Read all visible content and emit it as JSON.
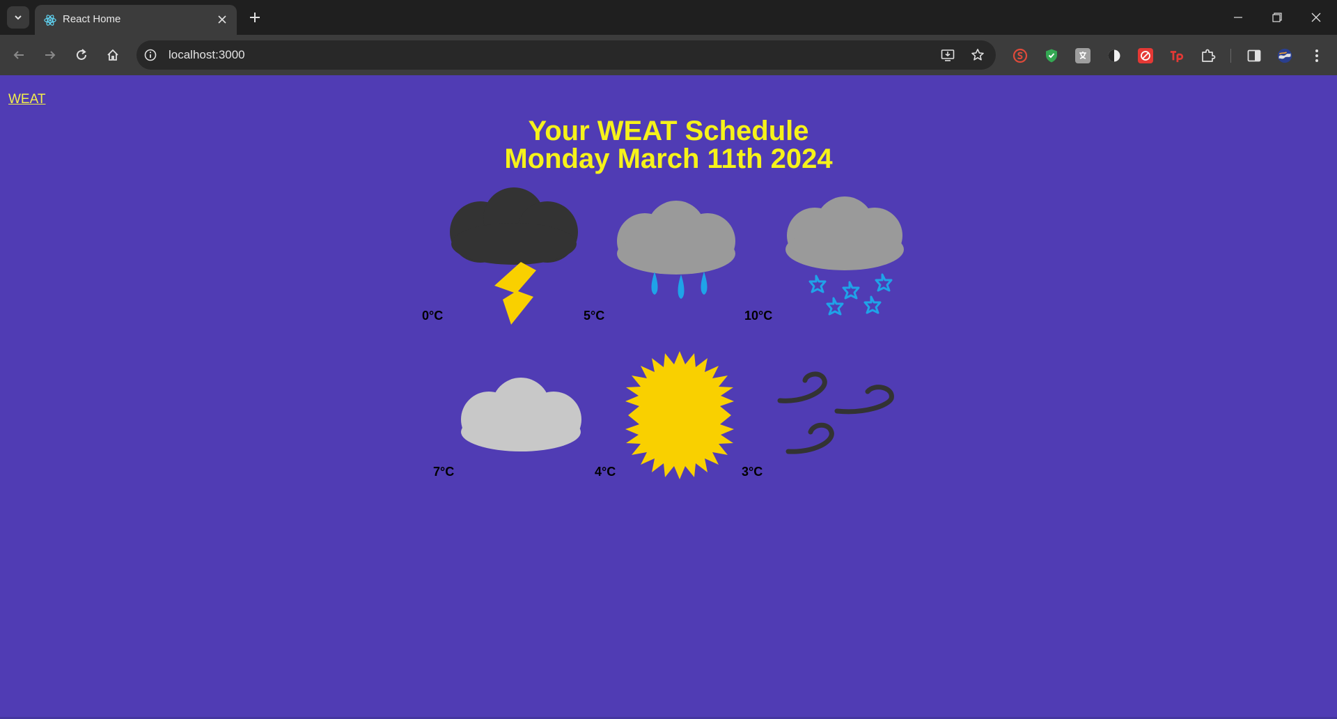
{
  "browser": {
    "tab_title": "React Home",
    "url": "localhost:3000"
  },
  "page": {
    "nav_link": "WEAT",
    "heading_line1": "Your WEAT Schedule",
    "heading_line2": "Monday March 11th 2024"
  },
  "forecast": [
    {
      "temp": "0°C",
      "icon": "thunderstorm-icon"
    },
    {
      "temp": "5°C",
      "icon": "rain-icon"
    },
    {
      "temp": "10°C",
      "icon": "snow-icon"
    },
    {
      "temp": "7°C",
      "icon": "cloudy-icon"
    },
    {
      "temp": "4°C",
      "icon": "sun-icon"
    },
    {
      "temp": "3°C",
      "icon": "wind-icon"
    }
  ],
  "colors": {
    "background": "#503cb4",
    "heading": "#f6f21a",
    "accent_yellow": "#f9d000",
    "storm_cloud": "#333333",
    "rain_cloud": "#9a9a9a",
    "light_cloud": "#c8c8c8",
    "water": "#1fa3e8"
  }
}
